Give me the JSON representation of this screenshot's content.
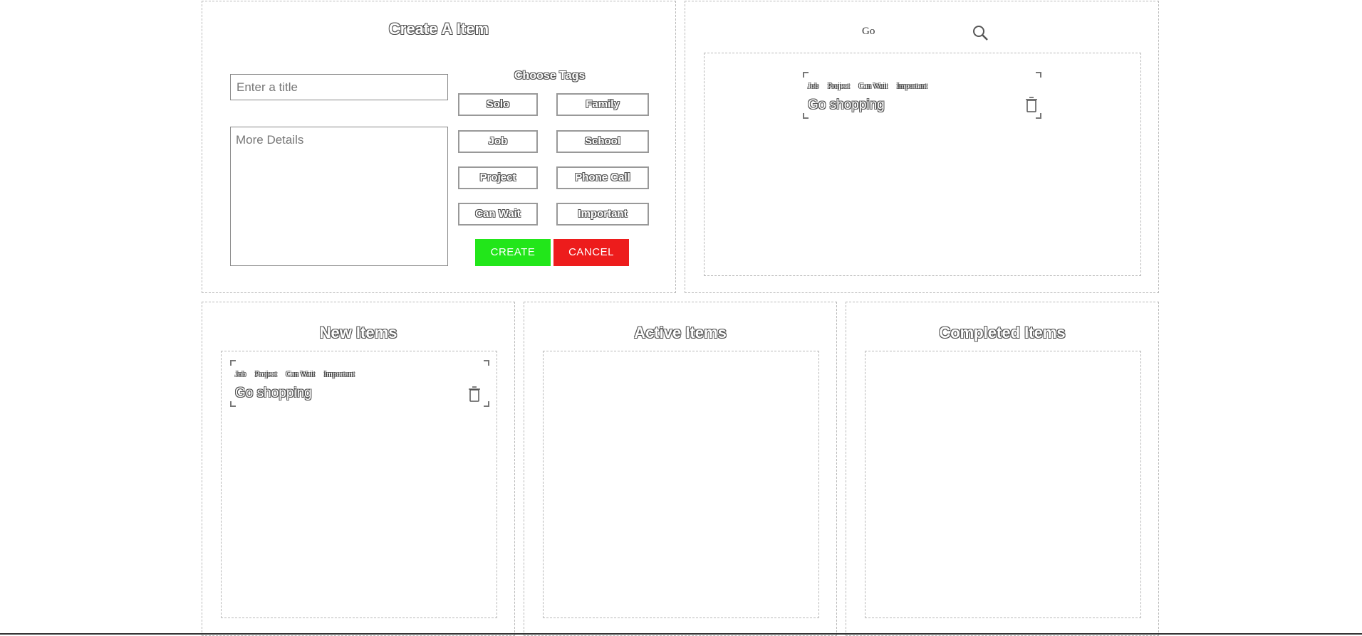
{
  "create_panel": {
    "heading": "Create A Item",
    "title_placeholder": "Enter a title",
    "details_placeholder": "More Details",
    "tags_heading": "Choose Tags",
    "tags": [
      "Solo",
      "Family",
      "Job",
      "School",
      "Project",
      "Phone Call",
      "Can Wait",
      "Important"
    ],
    "create_label": "CREATE",
    "cancel_label": "CANCEL",
    "create_color": "#22e61a",
    "cancel_color": "#ed1c1c"
  },
  "search_panel": {
    "query": "Go",
    "search_icon": "search-icon",
    "results": [
      {
        "tags": [
          "Job",
          "Project",
          "Can Wait",
          "Important"
        ],
        "title": "Go shopping",
        "delete_icon": "trash-icon"
      }
    ]
  },
  "columns": [
    {
      "heading": "New Items",
      "items": [
        {
          "tags": [
            "Job",
            "Project",
            "Can Wait",
            "Important"
          ],
          "title": "Go shopping",
          "delete_icon": "trash-icon"
        }
      ]
    },
    {
      "heading": "Active Items",
      "items": []
    },
    {
      "heading": "Completed Items",
      "items": []
    }
  ]
}
